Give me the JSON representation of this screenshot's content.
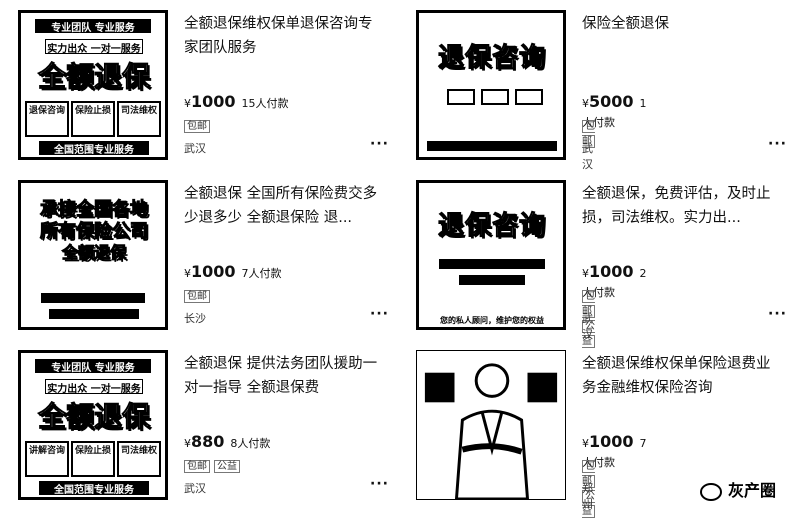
{
  "listings": [
    {
      "title": "全额退保维权保单退保咨询专家团队服务",
      "currency": "¥",
      "price": "1000",
      "paid": "15人付款",
      "tags": [
        "包邮"
      ],
      "location": "武汉",
      "thumb": {
        "top": "专业团队 专业服务",
        "mid": "实力出众 一对一服务",
        "big": "全额退保",
        "boxes": [
          "退保咨询",
          "保险止损",
          "司法维权"
        ],
        "bottom": "全国范围专业服务"
      }
    },
    {
      "title": "保险全额退保",
      "currency": "¥",
      "price": "5000",
      "paid": "1人付款",
      "tags": [
        "包邮"
      ],
      "location": "武汉",
      "thumb": {
        "big": "退保咨询"
      }
    },
    {
      "title": "全额退保 全国所有保险费交多少退多少 全额退保险 退...",
      "currency": "¥",
      "price": "1000",
      "paid": "7人付款",
      "tags": [
        "包邮"
      ],
      "location": "长沙",
      "thumb": {
        "top": "承接全国各地",
        "mid": "所有保险公司",
        "big": "全额退保"
      }
    },
    {
      "title": "全额退保，免费评估，及时止损，司法维权。实力出...",
      "currency": "¥",
      "price": "1000",
      "paid": "2人付款",
      "tags": [
        "包邮",
        "公益"
      ],
      "location": "武汉",
      "thumb": {
        "big": "退保咨询",
        "bottom": "您的私人顾问，维护您的权益"
      }
    },
    {
      "title": "全额退保 提供法务团队援助一对一指导 全额退保费",
      "currency": "¥",
      "price": "880",
      "paid": "8人付款",
      "tags": [
        "包邮",
        "公益"
      ],
      "location": "武汉",
      "thumb": {
        "top": "专业团队 专业服务",
        "mid": "实力出众 一对一服务",
        "big": "全额退保",
        "boxes": [
          "讲解咨询",
          "保险止损",
          "司法维权"
        ],
        "bottom": "全国范围专业服务"
      }
    },
    {
      "title": "全额退保维权保单保险退费业务金融维权保险咨询",
      "currency": "¥",
      "price": "1000",
      "paid": "7人付款",
      "tags": [
        "包邮",
        "公益"
      ],
      "location": "郑州",
      "thumb": {}
    }
  ],
  "watermark": "灰产圈",
  "more_icon": "ellipsis-icon"
}
